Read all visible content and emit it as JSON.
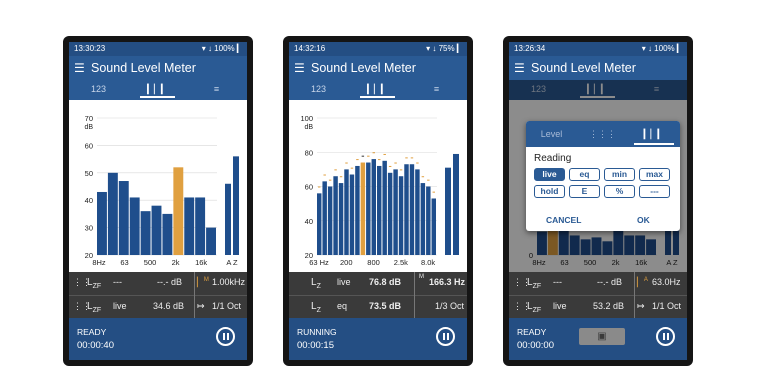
{
  "colors": {
    "bar": "#1f4e8c",
    "highlight": "#e0a040",
    "appbar": "#2a5a94",
    "statusbar": "#244e83",
    "readings_bg": "#3a3a3a"
  },
  "app_title": "Sound Level Meter",
  "tab_labels": {
    "numeric": "123",
    "spectrum_icon": "spectrum-bars-icon",
    "settings_icon": "sliders-icon"
  },
  "screens": [
    {
      "status_time": "13:30:23",
      "status_icons": "▾ ↓ 100% ▎",
      "chart_data": {
        "type": "bar",
        "y_unit": "dB",
        "y_ticks": [
          "70",
          "60",
          "50",
          "40",
          "30",
          "20"
        ],
        "ylim": [
          20,
          70
        ],
        "x_tick_labels": [
          "8Hz",
          "63",
          "500",
          "2k",
          "16k",
          "A Z"
        ],
        "values": [
          43,
          50,
          47,
          41,
          36,
          38,
          35,
          52,
          41,
          41,
          30
        ],
        "highlight_index": 7,
        "overall": [
          46,
          56
        ]
      },
      "readings": {
        "r1_label": "L",
        "r1_sub": "ZF",
        "r1_mode": "---",
        "r1_value": "--.- dB",
        "r1_right_sup": "M",
        "r1_right_value": "1.00kHz",
        "r2_label": "L",
        "r2_sub": "ZF",
        "r2_mode": "live",
        "r2_value": "34.6 dB",
        "r2_right_value": "1/1 Oct"
      },
      "footer": {
        "state": "READY",
        "elapsed": "00:00:40"
      }
    },
    {
      "status_time": "14:32:16",
      "status_icons": "▾ ↓ 75% ▎",
      "chart_data": {
        "type": "bar",
        "y_unit": "dB",
        "y_ticks": [
          "100",
          "80",
          "60",
          "40",
          "20"
        ],
        "ylim": [
          20,
          100
        ],
        "x_tick_labels": [
          "63 Hz",
          "200",
          "800",
          "2.5k",
          "8.0k"
        ],
        "values": [
          56,
          63,
          60,
          66,
          62,
          70,
          67,
          72,
          74,
          74,
          76,
          72,
          75,
          68,
          70,
          66,
          73,
          73,
          70,
          62,
          60,
          53
        ],
        "highlight_index": 8,
        "overall": [
          71,
          79
        ]
      },
      "readings": {
        "r1_label": "L",
        "r1_sub": "Z",
        "r1_mode": "live",
        "r1_value": "76.8 dB",
        "r1_right_sup": "M",
        "r1_right_value": "166.3 Hz",
        "r2_label": "L",
        "r2_sub": "Z",
        "r2_mode": "eq",
        "r2_value": "73.5 dB",
        "r2_right_value": "1/3 Oct"
      },
      "footer": {
        "state": "RUNNING",
        "elapsed": "00:00:15"
      }
    },
    {
      "status_time": "13:26:34",
      "status_icons": "▾ ↓ 100% ▎",
      "chart_data": {
        "type": "bar",
        "y_unit": "dB",
        "y_ticks": [
          "0"
        ],
        "ylim": [
          0,
          70
        ],
        "x_tick_labels": [
          "8Hz",
          "63",
          "500",
          "2k",
          "16k",
          "A Z"
        ],
        "values": [
          12,
          18,
          16,
          10,
          8,
          9,
          7,
          20,
          10,
          10,
          8
        ],
        "highlight_index": 1,
        "overall": [
          14,
          24
        ]
      },
      "readings": {
        "r1_label": "L",
        "r1_sub": "ZF",
        "r1_mode": "---",
        "r1_value": "--.- dB",
        "r1_right_sup": "A",
        "r1_right_value": "63.0Hz",
        "r2_label": "L",
        "r2_sub": "ZF",
        "r2_mode": "live",
        "r2_value": "53.2 dB",
        "r2_right_value": "1/1 Oct"
      },
      "footer": {
        "state": "READY",
        "elapsed": "00:00:00"
      },
      "dialog": {
        "tab_level": "Level",
        "heading": "Reading",
        "options": [
          "live",
          "eq",
          "min",
          "max",
          "hold",
          "E",
          "%",
          "---"
        ],
        "selected": "live",
        "cancel": "CANCEL",
        "ok": "OK"
      }
    }
  ]
}
